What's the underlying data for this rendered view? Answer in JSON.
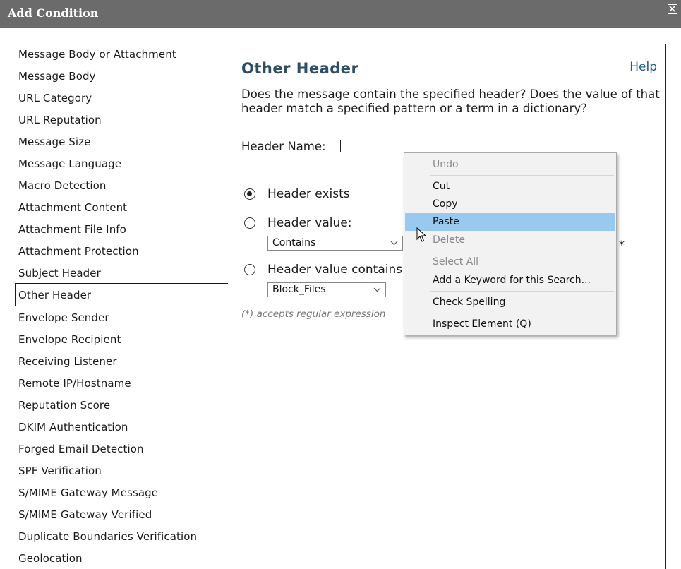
{
  "window": {
    "title": "Add Condition",
    "close_icon": "close-icon"
  },
  "sidebar": {
    "items": [
      "Message Body or Attachment",
      "Message Body",
      "URL Category",
      "URL Reputation",
      "Message Size",
      "Message Language",
      "Macro Detection",
      "Attachment Content",
      "Attachment File Info",
      "Attachment Protection",
      "Subject Header",
      "Other Header",
      "Envelope Sender",
      "Envelope Recipient",
      "Receiving Listener",
      "Remote IP/Hostname",
      "Reputation Score",
      "DKIM Authentication",
      "Forged Email Detection",
      "SPF Verification",
      "S/MIME Gateway Message",
      "S/MIME Gateway Verified",
      "Duplicate Boundaries Verification",
      "Geolocation"
    ],
    "selected": "Other Header"
  },
  "panel": {
    "title": "Other Header",
    "help": "Help",
    "description": "Does the message contain the specified header? Does the value of that header match a specified pattern or a term in a dictionary?",
    "header_name_label": "Header Name:",
    "header_name_value": "",
    "options": {
      "exists": {
        "label": "Header exists",
        "checked": true
      },
      "value": {
        "label": "Header value:",
        "checked": false,
        "operator": "Contains"
      },
      "contains": {
        "label": "Header value contains",
        "checked": false,
        "dictionary": "Block_Files"
      }
    },
    "asterisk": "*",
    "note": "(*) accepts regular expression"
  },
  "context_menu": {
    "items": [
      {
        "label": "Undo",
        "disabled": true
      },
      {
        "label": "Cut",
        "disabled": false
      },
      {
        "label": "Copy",
        "disabled": false
      },
      {
        "label": "Paste",
        "disabled": false,
        "highlighted": true
      },
      {
        "label": "Delete",
        "disabled": true
      },
      {
        "label": "Select All",
        "disabled": true
      },
      {
        "label": "Add a Keyword for this Search...",
        "disabled": false
      },
      {
        "label": "Check Spelling",
        "disabled": false
      },
      {
        "label": "Inspect Element (Q)",
        "disabled": false
      }
    ]
  },
  "colors": {
    "titlebar": "#6b6b6b",
    "panel_title": "#2e4e63",
    "help_link": "#1d5a86",
    "menu_highlight": "#99c9ef"
  }
}
